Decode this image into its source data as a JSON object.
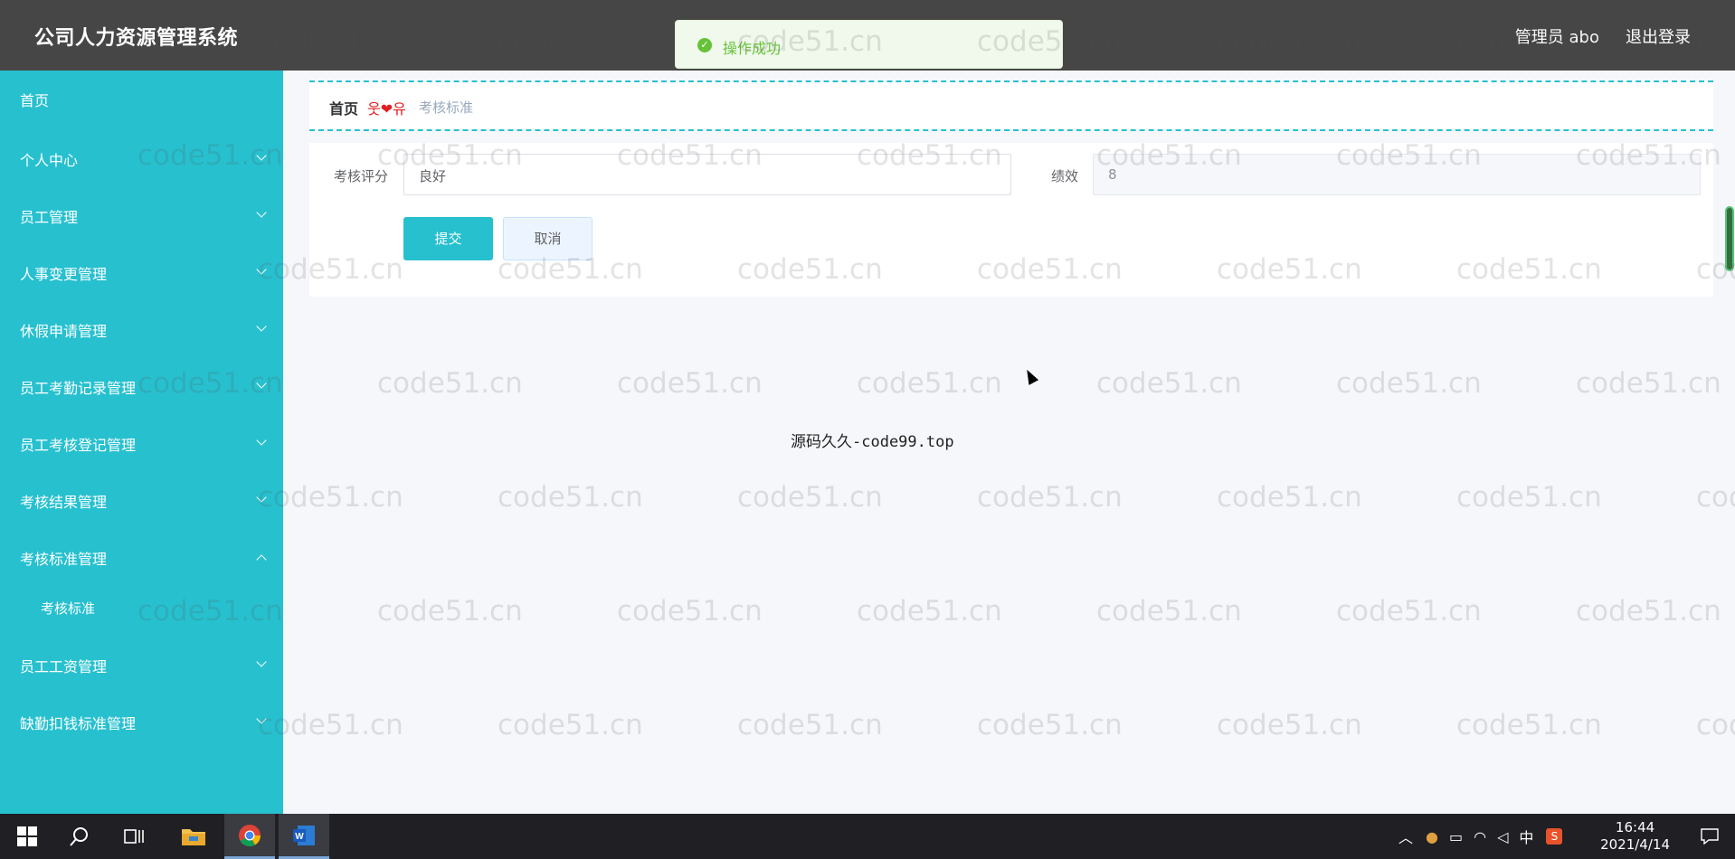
{
  "header": {
    "title": "公司人力资源管理系统",
    "user": "管理员 abo",
    "logout": "退出登录"
  },
  "toast": {
    "message": "操作成功"
  },
  "sidebar": {
    "items": [
      {
        "label": "首页"
      },
      {
        "label": "个人中心"
      },
      {
        "label": "员工管理"
      },
      {
        "label": "人事变更管理"
      },
      {
        "label": "休假申请管理"
      },
      {
        "label": "员工考勤记录管理"
      },
      {
        "label": "员工考核登记管理"
      },
      {
        "label": "考核结果管理"
      },
      {
        "label": "考核标准管理"
      },
      {
        "label": "考核标准"
      },
      {
        "label": "员工工资管理"
      },
      {
        "label": "缺勤扣钱标准管理"
      }
    ]
  },
  "breadcrumb": {
    "home": "首页",
    "separator": "웃❤유",
    "current": "考核标准"
  },
  "form": {
    "rating_label": "考核评分",
    "rating_value": "良好",
    "performance_label": "绩效",
    "performance_value": "8",
    "submit_label": "提交",
    "cancel_label": "取消"
  },
  "overlay": {
    "source_text": "源码久久-code99.top",
    "watermark_text": "code51.cn"
  },
  "taskbar": {
    "time": "16:44",
    "date": "2021/4/14",
    "ime": "中",
    "icons": [
      "windows-start-icon",
      "search-icon",
      "task-view-icon",
      "file-explorer-icon",
      "chrome-icon",
      "word-icon"
    ]
  },
  "colors": {
    "header_bg": "#464646",
    "sidebar_bg": "#27c0cf",
    "accent": "#27c0cf",
    "toast_green": "#67c23a"
  }
}
